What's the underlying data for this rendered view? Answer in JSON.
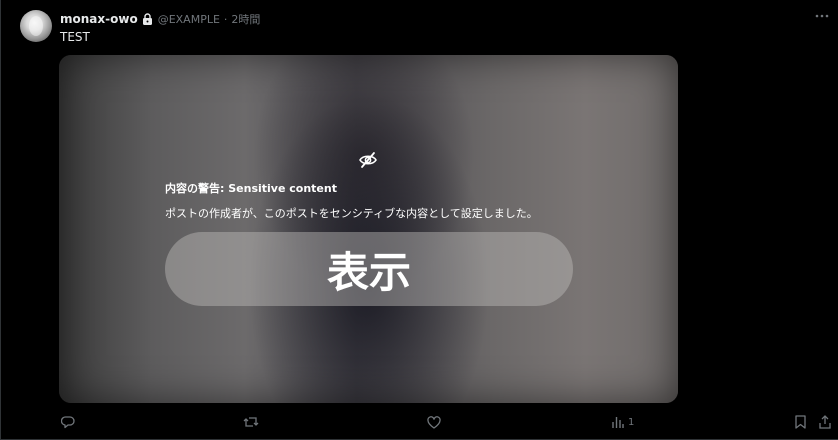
{
  "post": {
    "display_name": "monax-owo",
    "handle": "@EXAMPLE",
    "separator": "·",
    "time": "2時間",
    "text": "TEST",
    "protected_icon": "lock-icon",
    "more_icon": "more-horizontal-icon"
  },
  "media": {
    "warning_icon": "eye-off-icon",
    "warning_title": "内容の警告: Sensitive content",
    "warning_body": "ポストの作成者が、このポストをセンシティブな内容として設定しました。",
    "show_label": "表示"
  },
  "actions": {
    "reply_icon": "reply-icon",
    "repost_icon": "repost-icon",
    "like_icon": "like-icon",
    "views_icon": "views-icon",
    "views_count": "1",
    "bookmark_icon": "bookmark-icon",
    "share_icon": "share-icon"
  },
  "colors": {
    "background": "#000000",
    "text_primary": "#e7e9ea",
    "text_secondary": "#71767b",
    "divider": "#2f3336"
  }
}
